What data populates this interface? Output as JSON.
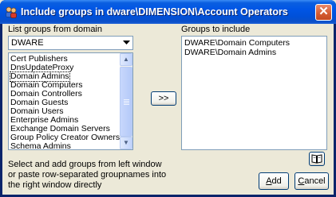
{
  "window": {
    "title": "Include groups in dware\\DIMENSION\\Account Operators",
    "close_glyph": "✕"
  },
  "left": {
    "label": "List groups from domain",
    "domain_value": "DWARE",
    "groups": [
      "Cert Publishers",
      "DnsUpdateProxy",
      "Domain Admins",
      "Domain Computers",
      "Domain Controllers",
      "Domain Guests",
      "Domain Users",
      "Enterprise Admins",
      "Exchange Domain Servers",
      "Group Policy Creator Owners",
      "Schema Admins"
    ],
    "hint_line1": "Select and add groups from left window",
    "hint_line2": "or paste row-separated groupnames into",
    "hint_line3": "the right window directly"
  },
  "move_button": {
    "label": ">>"
  },
  "right": {
    "label": "Groups to include",
    "lines": [
      "DWARE\\Domain Computers",
      "DWARE\\Domain Admins"
    ]
  },
  "buttons": {
    "add_prefix": "A",
    "add_rest": "dd",
    "cancel_prefix": "C",
    "cancel_rest": "ancel"
  },
  "icons": {
    "title": "group-icon",
    "browse": "book-icon"
  }
}
